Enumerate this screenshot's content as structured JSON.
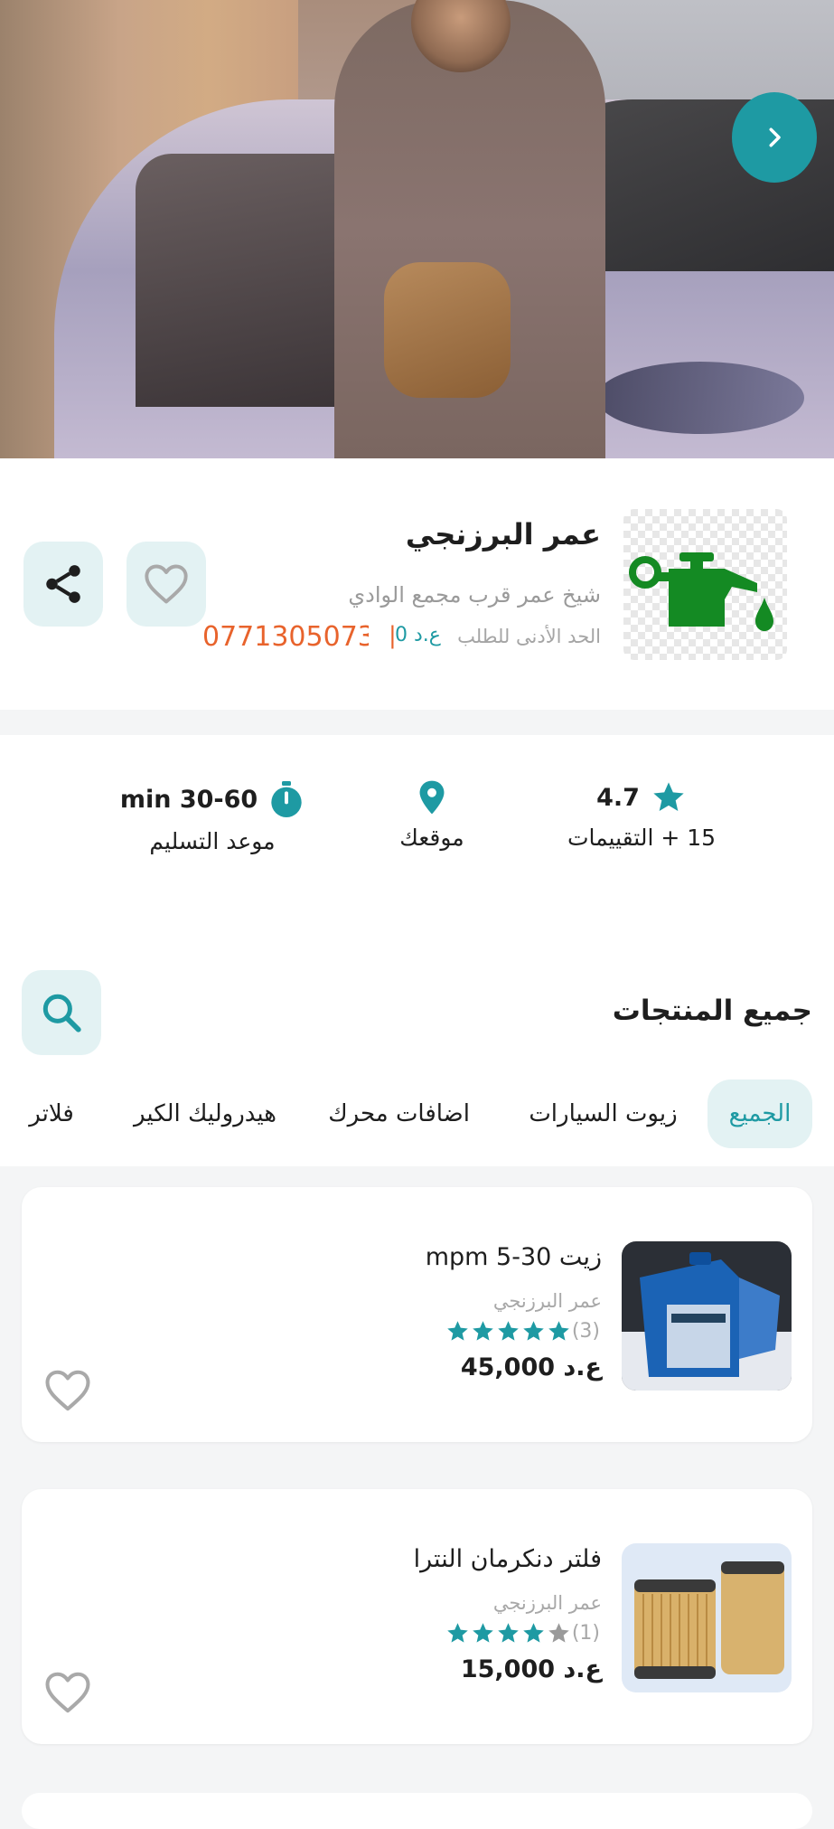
{
  "store": {
    "name": "عمر البرزنجي",
    "address": "شيخ عمر قرب مجمع الوادي",
    "min_order_label": "الحد الأدنى للطلب",
    "min_order_value": "ع.د 0",
    "separator": "|",
    "phone": "07713050733"
  },
  "info": {
    "rating_value": "4.7",
    "rating_count_label": "15 + التقييمات",
    "location_label": "موقعك",
    "delivery_time": "min 30-60",
    "delivery_label": "موعد التسليم"
  },
  "products_section": {
    "title": "جميع المنتجات",
    "tabs": [
      {
        "label": "الجميع",
        "active": true
      },
      {
        "label": "زيوت السيارات",
        "active": false
      },
      {
        "label": "اضافات محرك",
        "active": false
      },
      {
        "label": "هيدروليك الكير",
        "active": false
      },
      {
        "label": "فلاتر",
        "active": false
      }
    ]
  },
  "products": [
    {
      "name": "زيت 30-5  mpm",
      "store": "عمر البرزنجي",
      "rating_stars": 5,
      "rating_count": "(3)",
      "price": "ع.د 45,000"
    },
    {
      "name": "فلتر دنكرمان النترا",
      "store": "عمر البرزنجي",
      "rating_stars": 4,
      "rating_count": "(1)",
      "price": "ع.د 15,000"
    }
  ],
  "colors": {
    "accent": "#1e9aa3",
    "accent_soft": "#e3f2f3",
    "phone": "#e8632c",
    "logo_green": "#148a23",
    "star_empty": "#9a9a9a"
  },
  "icons": {
    "next": "chevron-right-icon",
    "favorite": "heart-outline-icon",
    "share": "share-icon",
    "rating": "star-icon",
    "location": "map-pin-icon",
    "delivery": "stopwatch-icon",
    "search": "search-icon",
    "logo": "oil-can-icon"
  }
}
